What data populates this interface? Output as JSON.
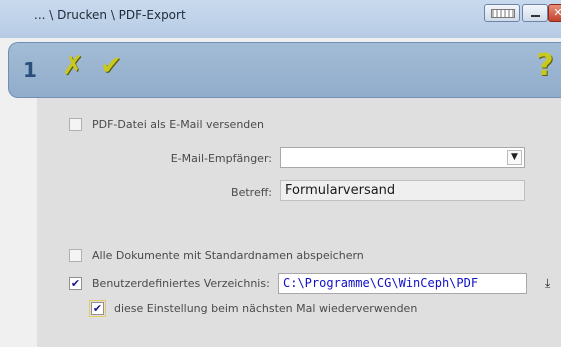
{
  "window": {
    "title": "... \\ Drucken \\ PDF-Export",
    "close_glyph": "✕"
  },
  "toolbar": {
    "step_number": "1",
    "cancel_icon": "✗",
    "ok_icon": "✔",
    "help_icon": "?"
  },
  "form": {
    "send_email": {
      "label": "PDF-Datei als E-Mail versenden",
      "checked": false
    },
    "email_recipient": {
      "label": "E-Mail-Empfänger:",
      "value": ""
    },
    "subject": {
      "label": "Betreff:",
      "value": "Formularversand"
    },
    "save_all_default": {
      "label": "Alle Dokumente mit Standardnamen abspeichern",
      "checked": false
    },
    "custom_dir": {
      "label": "Benutzerdefiniertes Verzeichnis:",
      "checked": true,
      "value": "C:\\Programme\\CG\\WinCeph\\PDF"
    },
    "reuse_setting": {
      "label": "diese Einstellung beim nächsten Mal wiederverwenden",
      "checked": true
    }
  },
  "icons": {
    "dropdown": "chevron-down-icon",
    "browse": "download-arrow-icon"
  },
  "colors": {
    "toolbar": "#9bb5d0",
    "path_text": "#1010c8",
    "icon_yellow": "#c8c81e"
  }
}
